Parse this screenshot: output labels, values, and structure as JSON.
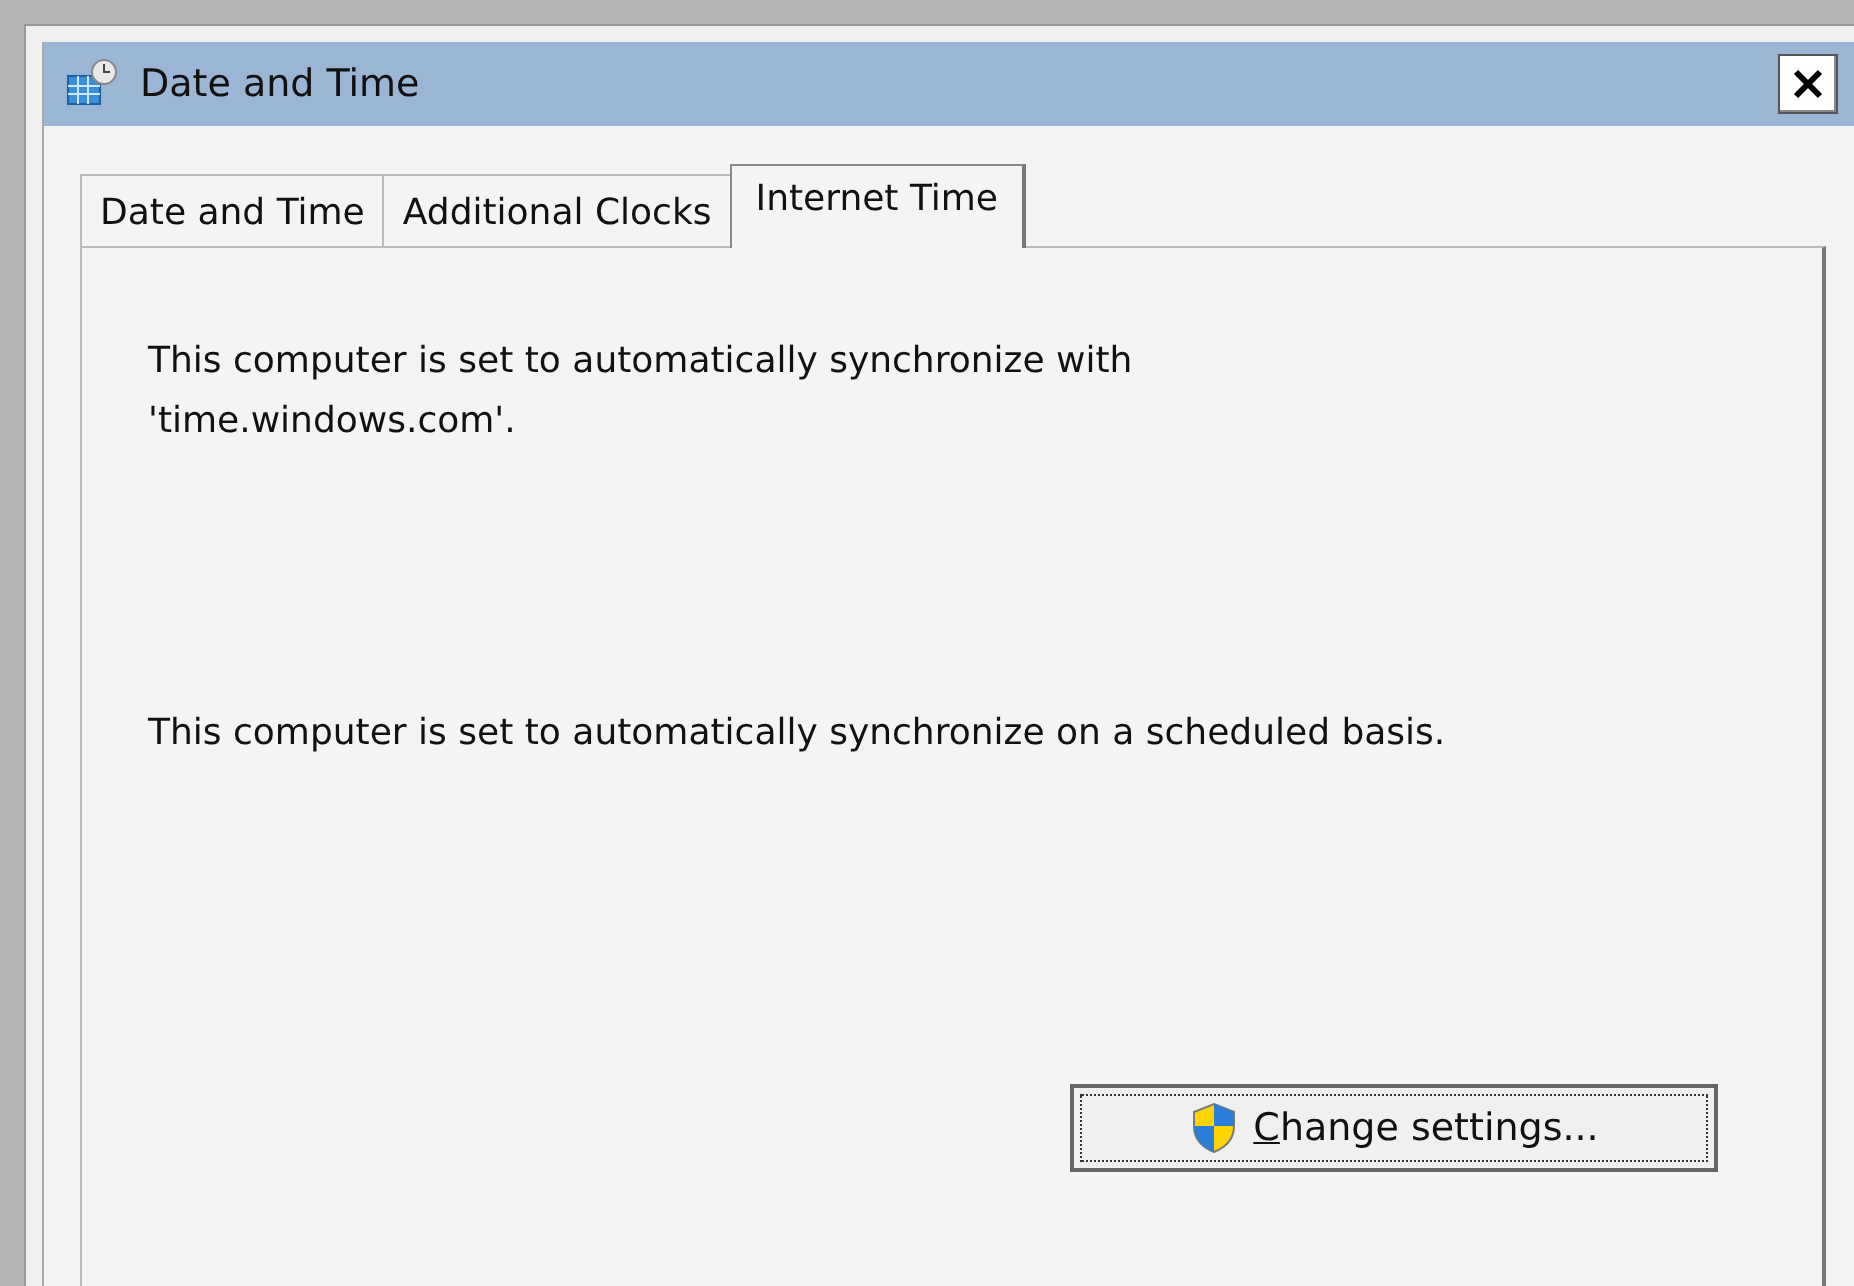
{
  "window": {
    "title": "Date and Time"
  },
  "tabs": [
    {
      "label": "Date and Time",
      "selected": false
    },
    {
      "label": "Additional Clocks",
      "selected": false
    },
    {
      "label": "Internet Time",
      "selected": true
    }
  ],
  "messages": [
    "This computer is set to automatically synchronize with 'time.windows.com'.",
    "This computer is set to automatically synchronize on a scheduled basis."
  ],
  "button": {
    "label_parts": [
      {
        "text": "C",
        "underlined": true
      },
      {
        "text": "hange settings...",
        "underlined": false
      }
    ],
    "focused": true
  }
}
